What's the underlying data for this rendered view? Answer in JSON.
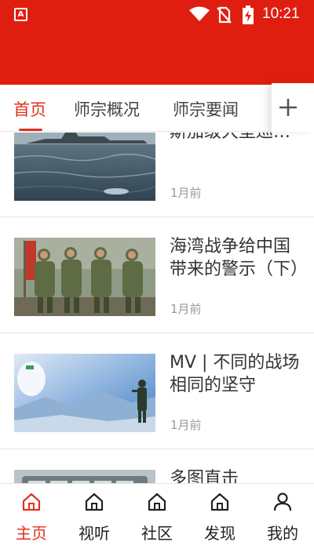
{
  "status_bar": {
    "time": "10:21",
    "app_icon_letter": "A",
    "icons": [
      "wifi-icon",
      "no-sim-icon",
      "battery-charging-icon"
    ]
  },
  "colors": {
    "header": "#e01e10",
    "accent": "#e0321e"
  },
  "tabs": [
    {
      "label": "首页",
      "active": true
    },
    {
      "label": "师宗概况",
      "active": false
    },
    {
      "label": "师宗要闻",
      "active": false
    }
  ],
  "tab_add_icon": "plus-icon",
  "feed": [
    {
      "title": "食之无味一阿拉斯加级大型巡洋舰",
      "time": "1月前",
      "image": "warship-at-sea"
    },
    {
      "title": "海湾战争给中国带来的警示（下）",
      "time": "1月前",
      "image": "soldiers-group-photo"
    },
    {
      "title": "MV | 不同的战场相同的坚守",
      "time": "1月前",
      "image": "soldier-and-medic-collage"
    },
    {
      "title": "多图直击",
      "time": "",
      "image": "military-vehicles"
    }
  ],
  "bottom_nav": [
    {
      "label": "主页",
      "icon": "home-icon",
      "active": true
    },
    {
      "label": "视听",
      "icon": "home-icon",
      "active": false
    },
    {
      "label": "社区",
      "icon": "home-icon",
      "active": false
    },
    {
      "label": "发现",
      "icon": "home-icon",
      "active": false
    },
    {
      "label": "我的",
      "icon": "user-icon",
      "active": false
    }
  ]
}
